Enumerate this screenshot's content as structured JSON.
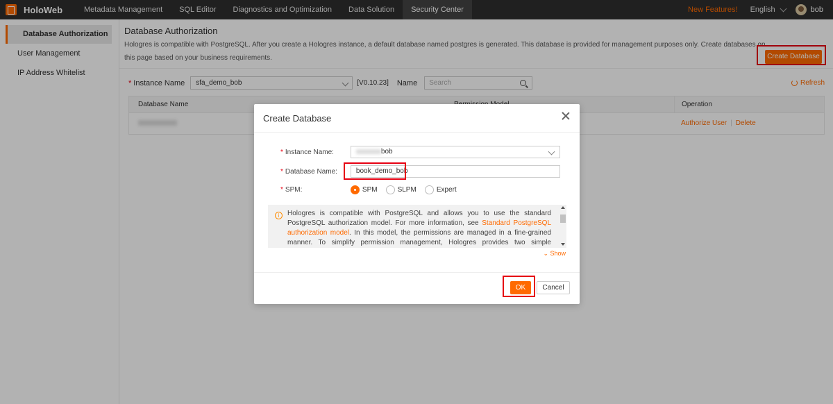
{
  "app": {
    "name": "HoloWeb"
  },
  "nav": [
    {
      "label": "Metadata Management"
    },
    {
      "label": "SQL Editor"
    },
    {
      "label": "Diagnostics and Optimization"
    },
    {
      "label": "Data Solution"
    },
    {
      "label": "Security Center"
    }
  ],
  "header": {
    "new_features": "New Features!",
    "language": "English",
    "user": "bob"
  },
  "sidebar": {
    "items": [
      {
        "label": "Database Authorization"
      },
      {
        "label": "User Management"
      },
      {
        "label": "IP Address Whitelist"
      }
    ]
  },
  "page": {
    "title": "Database Authorization",
    "description": "Hologres is compatible with PostgreSQL. After you create a Hologres instance, a default database named postgres is generated. This database is provided for management purposes only. Create databases on this page based on your business requirements.",
    "create_button": "Create Database"
  },
  "filter": {
    "instance_label": "Instance Name",
    "instance_value": "sfa_demo_bob",
    "version": "[V0.10.23]",
    "name_label": "Name",
    "search_placeholder": "Search",
    "refresh": "Refresh"
  },
  "table": {
    "columns": [
      "Database Name",
      "Permission Model",
      "Operation"
    ],
    "operations": {
      "authorize": "Authorize User",
      "delete": "Delete"
    }
  },
  "modal": {
    "title": "Create Database",
    "instance_label": "Instance Name:",
    "instance_value": "bob",
    "db_label": "Database Name:",
    "db_value": "book_demo_bob",
    "spm_label": "SPM:",
    "options": [
      "SPM",
      "SLPM",
      "Expert"
    ],
    "selected_option": "SPM",
    "info_pre": "Hologres is compatible with PostgreSQL and allows you to use the standard PostgreSQL authorization model. For more information, see ",
    "info_link": "Standard PostgreSQL authorization model",
    "info_post": ". In this model, the permissions are managed in a fine-grained manner. To simplify permission management, Hologres provides two simple permission models based on an understand of",
    "show": "Show",
    "ok": "OK",
    "cancel": "Cancel"
  },
  "colors": {
    "accent": "#ff6a00",
    "highlight": "#e60012",
    "topbar": "#2f2f2f"
  }
}
